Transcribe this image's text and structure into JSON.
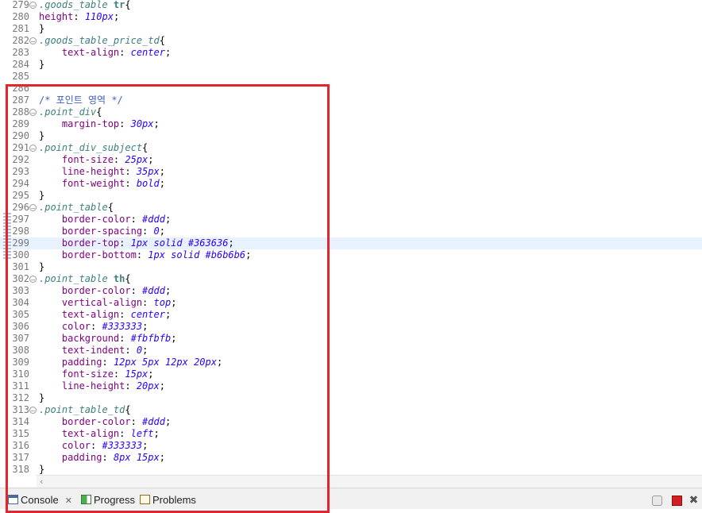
{
  "editor": {
    "lines": [
      {
        "n": "279",
        "fold": true,
        "parts": [
          {
            "t": ".goods_table ",
            "c": "sel"
          },
          {
            "t": "tr",
            "c": "tag"
          },
          {
            "t": "{",
            "c": "pl"
          }
        ]
      },
      {
        "n": "280",
        "parts": [
          {
            "t": "height",
            "c": "prop"
          },
          {
            "t": ": ",
            "c": "pl"
          },
          {
            "t": "110px",
            "c": "val"
          },
          {
            "t": ";",
            "c": "pl"
          }
        ]
      },
      {
        "n": "281",
        "parts": [
          {
            "t": "}",
            "c": "pl"
          }
        ]
      },
      {
        "n": "282",
        "fold": true,
        "parts": [
          {
            "t": ".goods_table_price_td",
            "c": "sel"
          },
          {
            "t": "{",
            "c": "pl"
          }
        ]
      },
      {
        "n": "283",
        "parts": [
          {
            "t": "    text-align",
            "c": "prop"
          },
          {
            "t": ": ",
            "c": "pl"
          },
          {
            "t": "center",
            "c": "val"
          },
          {
            "t": ";",
            "c": "pl"
          }
        ]
      },
      {
        "n": "284",
        "parts": [
          {
            "t": "}",
            "c": "pl"
          }
        ]
      },
      {
        "n": "285",
        "parts": []
      },
      {
        "n": "286",
        "parts": []
      },
      {
        "n": "287",
        "parts": [
          {
            "t": "/* 포인트 영역 */",
            "c": "cmt"
          }
        ]
      },
      {
        "n": "288",
        "fold": true,
        "parts": [
          {
            "t": ".point_div",
            "c": "sel"
          },
          {
            "t": "{",
            "c": "pl"
          }
        ]
      },
      {
        "n": "289",
        "parts": [
          {
            "t": "    margin-top",
            "c": "prop"
          },
          {
            "t": ": ",
            "c": "pl"
          },
          {
            "t": "30px",
            "c": "val"
          },
          {
            "t": ";",
            "c": "pl"
          }
        ]
      },
      {
        "n": "290",
        "parts": [
          {
            "t": "}",
            "c": "pl"
          }
        ]
      },
      {
        "n": "291",
        "fold": true,
        "parts": [
          {
            "t": ".point_div_subject",
            "c": "sel"
          },
          {
            "t": "{",
            "c": "pl"
          }
        ]
      },
      {
        "n": "292",
        "parts": [
          {
            "t": "    font-size",
            "c": "prop"
          },
          {
            "t": ": ",
            "c": "pl"
          },
          {
            "t": "25px",
            "c": "val"
          },
          {
            "t": ";",
            "c": "pl"
          }
        ]
      },
      {
        "n": "293",
        "parts": [
          {
            "t": "    line-height",
            "c": "prop"
          },
          {
            "t": ": ",
            "c": "pl"
          },
          {
            "t": "35px",
            "c": "val"
          },
          {
            "t": ";",
            "c": "pl"
          }
        ]
      },
      {
        "n": "294",
        "parts": [
          {
            "t": "    font-weight",
            "c": "prop"
          },
          {
            "t": ": ",
            "c": "pl"
          },
          {
            "t": "bold",
            "c": "val"
          },
          {
            "t": ";",
            "c": "pl"
          }
        ]
      },
      {
        "n": "295",
        "parts": [
          {
            "t": "}",
            "c": "pl"
          }
        ]
      },
      {
        "n": "296",
        "fold": true,
        "parts": [
          {
            "t": ".point_table",
            "c": "sel"
          },
          {
            "t": "{",
            "c": "pl"
          }
        ]
      },
      {
        "n": "297",
        "parts": [
          {
            "t": "    border-color",
            "c": "prop"
          },
          {
            "t": ": ",
            "c": "pl"
          },
          {
            "t": "#ddd",
            "c": "val"
          },
          {
            "t": ";",
            "c": "pl"
          }
        ]
      },
      {
        "n": "298",
        "parts": [
          {
            "t": "    border-spacing",
            "c": "prop"
          },
          {
            "t": ": ",
            "c": "pl"
          },
          {
            "t": "0",
            "c": "val"
          },
          {
            "t": ";",
            "c": "pl"
          }
        ]
      },
      {
        "n": "299",
        "highlight": true,
        "parts": [
          {
            "t": "    border-top",
            "c": "prop"
          },
          {
            "t": ": ",
            "c": "pl"
          },
          {
            "t": "1px solid #363636",
            "c": "val"
          },
          {
            "t": ";",
            "c": "pl"
          }
        ]
      },
      {
        "n": "300",
        "parts": [
          {
            "t": "    border-bottom",
            "c": "prop"
          },
          {
            "t": ": ",
            "c": "pl"
          },
          {
            "t": "1px solid #b6b6b6",
            "c": "val"
          },
          {
            "t": ";",
            "c": "pl"
          }
        ]
      },
      {
        "n": "301",
        "parts": [
          {
            "t": "}",
            "c": "pl"
          }
        ]
      },
      {
        "n": "302",
        "fold": true,
        "parts": [
          {
            "t": ".point_table ",
            "c": "sel"
          },
          {
            "t": "th",
            "c": "tag"
          },
          {
            "t": "{",
            "c": "pl"
          }
        ]
      },
      {
        "n": "303",
        "parts": [
          {
            "t": "    border-color",
            "c": "prop"
          },
          {
            "t": ": ",
            "c": "pl"
          },
          {
            "t": "#ddd",
            "c": "val"
          },
          {
            "t": ";",
            "c": "pl"
          }
        ]
      },
      {
        "n": "304",
        "parts": [
          {
            "t": "    vertical-align",
            "c": "prop"
          },
          {
            "t": ": ",
            "c": "pl"
          },
          {
            "t": "top",
            "c": "val"
          },
          {
            "t": ";",
            "c": "pl"
          }
        ]
      },
      {
        "n": "305",
        "parts": [
          {
            "t": "    text-align",
            "c": "prop"
          },
          {
            "t": ": ",
            "c": "pl"
          },
          {
            "t": "center",
            "c": "val"
          },
          {
            "t": ";",
            "c": "pl"
          }
        ]
      },
      {
        "n": "306",
        "parts": [
          {
            "t": "    color",
            "c": "prop"
          },
          {
            "t": ": ",
            "c": "pl"
          },
          {
            "t": "#333333",
            "c": "val"
          },
          {
            "t": ";",
            "c": "pl"
          }
        ]
      },
      {
        "n": "307",
        "parts": [
          {
            "t": "    background",
            "c": "prop"
          },
          {
            "t": ": ",
            "c": "pl"
          },
          {
            "t": "#fbfbfb",
            "c": "val"
          },
          {
            "t": ";",
            "c": "pl"
          }
        ]
      },
      {
        "n": "308",
        "parts": [
          {
            "t": "    text-indent",
            "c": "prop"
          },
          {
            "t": ": ",
            "c": "pl"
          },
          {
            "t": "0",
            "c": "val"
          },
          {
            "t": ";",
            "c": "pl"
          }
        ]
      },
      {
        "n": "309",
        "parts": [
          {
            "t": "    padding",
            "c": "prop"
          },
          {
            "t": ": ",
            "c": "pl"
          },
          {
            "t": "12px 5px 12px 20px",
            "c": "val"
          },
          {
            "t": ";",
            "c": "pl"
          }
        ]
      },
      {
        "n": "310",
        "parts": [
          {
            "t": "    font-size",
            "c": "prop"
          },
          {
            "t": ": ",
            "c": "pl"
          },
          {
            "t": "15px",
            "c": "val"
          },
          {
            "t": ";",
            "c": "pl"
          }
        ]
      },
      {
        "n": "311",
        "parts": [
          {
            "t": "    line-height",
            "c": "prop"
          },
          {
            "t": ": ",
            "c": "pl"
          },
          {
            "t": "20px",
            "c": "val"
          },
          {
            "t": ";",
            "c": "pl"
          }
        ]
      },
      {
        "n": "312",
        "parts": [
          {
            "t": "}",
            "c": "pl"
          }
        ]
      },
      {
        "n": "313",
        "fold": true,
        "parts": [
          {
            "t": ".point_table_td",
            "c": "sel"
          },
          {
            "t": "{",
            "c": "pl"
          }
        ]
      },
      {
        "n": "314",
        "parts": [
          {
            "t": "    border-color",
            "c": "prop"
          },
          {
            "t": ": ",
            "c": "pl"
          },
          {
            "t": "#ddd",
            "c": "val"
          },
          {
            "t": ";",
            "c": "pl"
          }
        ]
      },
      {
        "n": "315",
        "parts": [
          {
            "t": "    text-align",
            "c": "prop"
          },
          {
            "t": ": ",
            "c": "pl"
          },
          {
            "t": "left",
            "c": "val"
          },
          {
            "t": ";",
            "c": "pl"
          }
        ]
      },
      {
        "n": "316",
        "parts": [
          {
            "t": "    color",
            "c": "prop"
          },
          {
            "t": ": ",
            "c": "pl"
          },
          {
            "t": "#333333",
            "c": "val"
          },
          {
            "t": ";",
            "c": "pl"
          }
        ]
      },
      {
        "n": "317",
        "parts": [
          {
            "t": "    padding",
            "c": "prop"
          },
          {
            "t": ": ",
            "c": "pl"
          },
          {
            "t": "8px 15px",
            "c": "val"
          },
          {
            "t": ";",
            "c": "pl"
          }
        ]
      },
      {
        "n": "318",
        "parts": [
          {
            "t": "}",
            "c": "pl"
          }
        ]
      }
    ]
  },
  "bottom_tabs": {
    "console_label": "Console",
    "progress_label": "Progress",
    "problems_label": "Problems"
  },
  "icons": {
    "fold": "fold-minus-icon",
    "console": "console-icon",
    "progress": "progress-icon",
    "problems": "problems-icon",
    "sync": "sync-icon",
    "terminate": "terminate-icon",
    "remove": "remove-all-icon"
  },
  "colors": {
    "annotation_box": "#e5252b",
    "current_line": "#e8f2fe",
    "selector": "#3f7f7f",
    "property": "#7f007f",
    "value": "#2a00ff",
    "comment": "#3f5fbf"
  }
}
